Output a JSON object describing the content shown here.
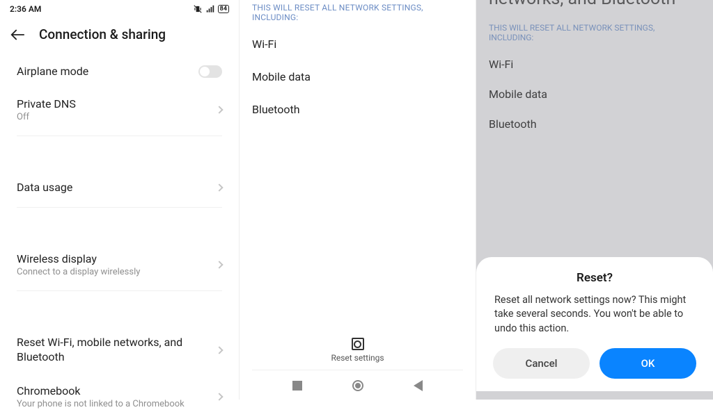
{
  "statusbar": {
    "time": "2:36 AM",
    "battery": "84"
  },
  "panel1": {
    "title": "Connection & sharing",
    "airplane": {
      "label": "Airplane mode",
      "on": false
    },
    "private_dns": {
      "label": "Private DNS",
      "sub": "Off"
    },
    "data_usage": {
      "label": "Data usage"
    },
    "wireless_display": {
      "label": "Wireless display",
      "sub": "Connect to a display wirelessly"
    },
    "reset": {
      "label": "Reset Wi-Fi, mobile networks, and Bluetooth"
    },
    "chromebook": {
      "label": "Chromebook",
      "sub": "Your phone is not linked to a Chromebook"
    }
  },
  "panel2": {
    "section": "THIS WILL RESET ALL NETWORK SETTINGS, INCLUDING:",
    "items": [
      "Wi-Fi",
      "Mobile data",
      "Bluetooth"
    ],
    "reset_button": "Reset settings"
  },
  "panel3": {
    "title_partial": "networks, and Bluetooth",
    "section": "THIS WILL RESET ALL NETWORK SETTINGS, INCLUDING:",
    "items": [
      "Wi-Fi",
      "Mobile data",
      "Bluetooth"
    ],
    "dialog": {
      "title": "Reset?",
      "message": "Reset all network settings now? This might take several seconds. You won't be able to undo this action.",
      "cancel": "Cancel",
      "ok": "OK"
    }
  }
}
